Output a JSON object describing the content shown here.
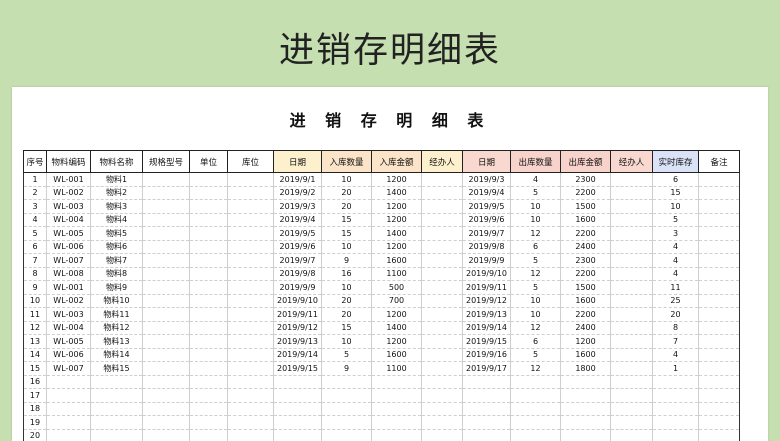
{
  "banner_title": "进销存明细表",
  "sheet_title": "进 销 存 明 细 表",
  "colors": {
    "background": "#c5dfb0",
    "in_header": "#fbe4c8",
    "out_header": "#f8d3cb",
    "stock_header": "#d9e2f6"
  },
  "columns": [
    "序号",
    "物料编码",
    "物料名称",
    "规格型号",
    "单位",
    "库位",
    "日期",
    "入库数量",
    "入库金额",
    "经办人",
    "日期",
    "出库数量",
    "出库金额",
    "经办人",
    "实时库存",
    "备注"
  ],
  "rows": [
    [
      "1",
      "WL-001",
      "物料1",
      "",
      "",
      "",
      "2019/9/1",
      "10",
      "1200",
      "",
      "2019/9/3",
      "4",
      "2300",
      "",
      "6",
      ""
    ],
    [
      "2",
      "WL-002",
      "物料2",
      "",
      "",
      "",
      "2019/9/2",
      "20",
      "1400",
      "",
      "2019/9/4",
      "5",
      "2200",
      "",
      "15",
      ""
    ],
    [
      "3",
      "WL-003",
      "物料3",
      "",
      "",
      "",
      "2019/9/3",
      "20",
      "1200",
      "",
      "2019/9/5",
      "10",
      "1500",
      "",
      "10",
      ""
    ],
    [
      "4",
      "WL-004",
      "物料4",
      "",
      "",
      "",
      "2019/9/4",
      "15",
      "1200",
      "",
      "2019/9/6",
      "10",
      "1600",
      "",
      "5",
      ""
    ],
    [
      "5",
      "WL-005",
      "物料5",
      "",
      "",
      "",
      "2019/9/5",
      "15",
      "1400",
      "",
      "2019/9/7",
      "12",
      "2200",
      "",
      "3",
      ""
    ],
    [
      "6",
      "WL-006",
      "物料6",
      "",
      "",
      "",
      "2019/9/6",
      "10",
      "1200",
      "",
      "2019/9/8",
      "6",
      "2400",
      "",
      "4",
      ""
    ],
    [
      "7",
      "WL-007",
      "物料7",
      "",
      "",
      "",
      "2019/9/7",
      "9",
      "1600",
      "",
      "2019/9/9",
      "5",
      "2300",
      "",
      "4",
      ""
    ],
    [
      "8",
      "WL-008",
      "物料8",
      "",
      "",
      "",
      "2019/9/8",
      "16",
      "1100",
      "",
      "2019/9/10",
      "12",
      "2200",
      "",
      "4",
      ""
    ],
    [
      "9",
      "WL-001",
      "物料9",
      "",
      "",
      "",
      "2019/9/9",
      "10",
      "500",
      "",
      "2019/9/11",
      "5",
      "1500",
      "",
      "11",
      ""
    ],
    [
      "10",
      "WL-002",
      "物料10",
      "",
      "",
      "",
      "2019/9/10",
      "20",
      "700",
      "",
      "2019/9/12",
      "10",
      "1600",
      "",
      "25",
      ""
    ],
    [
      "11",
      "WL-003",
      "物料11",
      "",
      "",
      "",
      "2019/9/11",
      "20",
      "1200",
      "",
      "2019/9/13",
      "10",
      "2200",
      "",
      "20",
      ""
    ],
    [
      "12",
      "WL-004",
      "物料12",
      "",
      "",
      "",
      "2019/9/12",
      "15",
      "1400",
      "",
      "2019/9/14",
      "12",
      "2400",
      "",
      "8",
      ""
    ],
    [
      "13",
      "WL-005",
      "物料13",
      "",
      "",
      "",
      "2019/9/13",
      "10",
      "1200",
      "",
      "2019/9/15",
      "6",
      "1200",
      "",
      "7",
      ""
    ],
    [
      "14",
      "WL-006",
      "物料14",
      "",
      "",
      "",
      "2019/9/14",
      "5",
      "1600",
      "",
      "2019/9/16",
      "5",
      "1600",
      "",
      "4",
      ""
    ],
    [
      "15",
      "WL-007",
      "物料15",
      "",
      "",
      "",
      "2019/9/15",
      "9",
      "1100",
      "",
      "2019/9/17",
      "12",
      "1800",
      "",
      "1",
      ""
    ],
    [
      "16",
      "",
      "",
      "",
      "",
      "",
      "",
      "",
      "",
      "",
      "",
      "",
      "",
      "",
      "",
      ""
    ],
    [
      "17",
      "",
      "",
      "",
      "",
      "",
      "",
      "",
      "",
      "",
      "",
      "",
      "",
      "",
      "",
      ""
    ],
    [
      "18",
      "",
      "",
      "",
      "",
      "",
      "",
      "",
      "",
      "",
      "",
      "",
      "",
      "",
      "",
      ""
    ],
    [
      "19",
      "",
      "",
      "",
      "",
      "",
      "",
      "",
      "",
      "",
      "",
      "",
      "",
      "",
      "",
      ""
    ],
    [
      "20",
      "",
      "",
      "",
      "",
      "",
      "",
      "",
      "",
      "",
      "",
      "",
      "",
      "",
      "",
      ""
    ]
  ]
}
